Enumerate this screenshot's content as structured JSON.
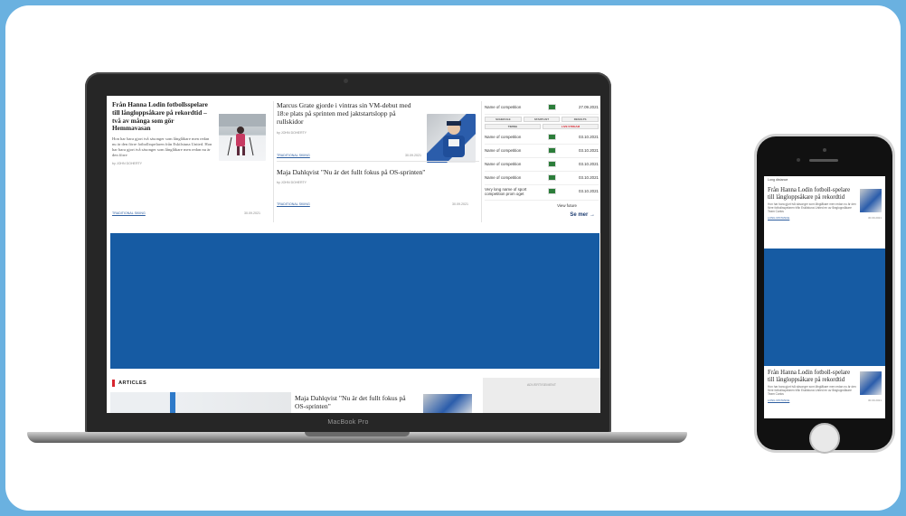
{
  "laptop": {
    "label": "MacBook Pro",
    "col1": {
      "title": "Från Hanna Lodin fotbollsspelare till långloppsåkare på rekordtid – två av många som gör Hemmavasan",
      "body": "Hon har bara gjort två säsonger som långlåkare men redan nu är den förre fotbollsspelaren från Eskilstuna United. Hon har bara gjort två säsonger som långlåkare men redan nu är den förre",
      "author": "by JOHN DOHERTY",
      "tag": "TRADITIONAL SKIING",
      "date": "30.09.2021"
    },
    "col2": {
      "title1": "Marcus Grate gjorde i vintras sin VM-debut med 18:e plats på sprinten med jaktstartslopp på rullskidor",
      "author1": "by JOHN DOHERTY",
      "tag1": "TRADITIONAL SKIING",
      "date1": "30.09.2021",
      "title2": "Maja Dahlqvist \"Nu är det fullt fokus på OS-sprinten\"",
      "author2": "by JOHN DOHERTY",
      "tag2": "TRADITIONAL SKIING",
      "date2": "30.09.2021"
    },
    "sidebar": {
      "competitions": [
        {
          "name": "Name of competition",
          "date": "27.09.2021"
        },
        {
          "name": "Name of competition",
          "date": "03.10.2021"
        },
        {
          "name": "Name of competition",
          "date": "03.10.2021"
        },
        {
          "name": "Name of competition",
          "date": "03.10.2021"
        },
        {
          "name": "Name of competition",
          "date": "03.10.2021"
        },
        {
          "name": "Very long name of sport competition prom oget",
          "date": "03.10.2021"
        }
      ],
      "buttons": [
        "SCHEDULE",
        "STARTLIST",
        "RESULTS"
      ],
      "buttons2": [
        "TIMING",
        "LIVE STREAM"
      ],
      "view_future": "View future",
      "see_more": "Se mer →"
    },
    "articles_header": "ARTICLES",
    "article_title": "Maja Dahlqvist \"Nu är det fullt fokus på OS-sprinten\"",
    "advertisement": "ADVERTISEMENT"
  },
  "phone": {
    "label": "Long distance",
    "article1": {
      "title": "Från Hanna Lodin fotboll-spelare till långloppsåkare på rekordtid",
      "body": "Hon har bara gjort två säsonger som långlåkare men redan nu är den förre fotbollsspelaren från Eskilstuna United en av långloppsåkare Team Carlos",
      "tag": "LONG DISTANCE",
      "date": "30.09.2021"
    },
    "article2": {
      "title": "Från Hanna Lodin fotboll-spelare till långloppsåkare på rekordtid",
      "body": "Hon har bara gjort två säsonger som långlåkare men redan nu är den förre fotbollsspelaren från Eskilstuna United en av långloppsåkare Team Carlos",
      "tag": "LONG DISTANCE",
      "date": "30.09.2021"
    }
  },
  "colors": {
    "background": "#6ab1e0",
    "banner": "#165ba3",
    "accent_red": "#d7262f"
  }
}
